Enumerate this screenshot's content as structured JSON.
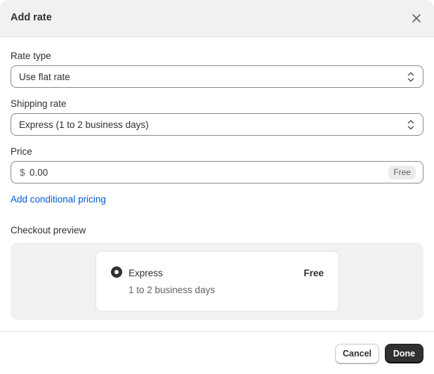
{
  "modal": {
    "title": "Add rate",
    "close_icon": "close-icon"
  },
  "rate_type": {
    "label": "Rate type",
    "value": "Use flat rate",
    "icon": "chevron-up-down-icon"
  },
  "shipping_rate": {
    "label": "Shipping rate",
    "value": "Express (1 to 2 business days)",
    "icon": "chevron-up-down-icon"
  },
  "price": {
    "label": "Price",
    "currency": "$",
    "value": "0.00",
    "badge": "Free"
  },
  "conditional_link": "Add conditional pricing",
  "checkout_preview": {
    "label": "Checkout preview",
    "option_name": "Express",
    "option_price": "Free",
    "option_detail": "1 to 2 business days",
    "selected": true
  },
  "footer": {
    "cancel_label": "Cancel",
    "done_label": "Done"
  },
  "colors": {
    "link": "#005bd3",
    "primary_button": "#303030",
    "header_bg": "#f1f1f1"
  }
}
